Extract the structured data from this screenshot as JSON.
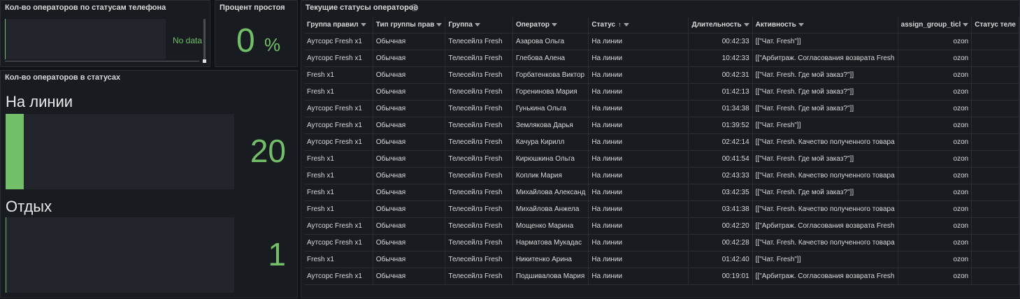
{
  "panel_phone": {
    "title": "Кол-во операторов по статусам телефона",
    "no_data": "No data"
  },
  "panel_idle": {
    "title": "Процент простоя",
    "value": "0",
    "unit": "%"
  },
  "panel_status": {
    "title": "Кол-во операторов в статусах",
    "gauges": [
      {
        "label": "На линии",
        "value": "20",
        "fill_fraction": 0.08
      },
      {
        "label": "Отдых",
        "value": "1",
        "fill_fraction": 0.0
      }
    ]
  },
  "panel_table": {
    "title": "Текущие статусы операторов",
    "columns": [
      "Группа правил",
      "Тип группы прав",
      "Группа",
      "Оператор",
      "Статус",
      "Длительность",
      "Активность",
      "assign_group_ticl",
      "Статус теле"
    ],
    "rows": [
      [
        "Аутсорс Fresh x1",
        "Обычная",
        "Телесейлз Fresh",
        "Азарова Ольга",
        "На линии",
        "00:42:33",
        "[[\"Чат. Fresh\"]]",
        "ozon",
        ""
      ],
      [
        "Аутсорс Fresh x1",
        "Обычная",
        "Телесейлз Fresh",
        "Глебова Алена",
        "На линии",
        "10:42:33",
        "[[\"Арбитраж. Согласования возврата Fresh",
        "ozon",
        ""
      ],
      [
        "Fresh x1",
        "Обычная",
        "Телесейлз Fresh",
        "Горбатенкова Виктор",
        "На линии",
        "00:42:31",
        "[[\"Чат. Fresh. Где мой заказ?\"]]",
        "ozon",
        ""
      ],
      [
        "Fresh x1",
        "Обычная",
        "Телесейлз Fresh",
        "Горенинова Мария",
        "На линии",
        "01:42:13",
        "[[\"Чат. Fresh. Где мой заказ?\"]]",
        "ozon",
        ""
      ],
      [
        "Аутсорс Fresh x1",
        "Обычная",
        "Телесейлз Fresh",
        "Гунькина Ольга",
        "На линии",
        "01:34:38",
        "[[\"Чат. Fresh. Где мой заказ?\"]]",
        "ozon",
        ""
      ],
      [
        "Аутсорс Fresh x1",
        "Обычная",
        "Телесейлз Fresh",
        "Землякова Дарья",
        "На линии",
        "01:39:52",
        "[[\"Чат. Fresh\"]]",
        "ozon",
        ""
      ],
      [
        "Аутсорс Fresh x1",
        "Обычная",
        "Телесейлз Fresh",
        "Качура Кирилл",
        "На линии",
        "02:42:14",
        "[[\"Чат. Fresh. Качество полученного товара",
        "ozon",
        ""
      ],
      [
        "Fresh x1",
        "Обычная",
        "Телесейлз Fresh",
        "Кирюшкина Ольга",
        "На линии",
        "00:41:54",
        "[[\"Чат. Fresh. Где мой заказ?\"]]",
        "ozon",
        ""
      ],
      [
        "Fresh x1",
        "Обычная",
        "Телесейлз Fresh",
        "Коплик Мария",
        "На линии",
        "02:43:33",
        "[[\"Чат. Fresh. Качество полученного товара",
        "ozon",
        ""
      ],
      [
        "Fresh x1",
        "Обычная",
        "Телесейлз Fresh",
        "Михайлова Александ",
        "На линии",
        "03:42:35",
        "[[\"Чат. Fresh. Где мой заказ?\"]]",
        "ozon",
        ""
      ],
      [
        "Fresh x1",
        "Обычная",
        "Телесейлз Fresh",
        "Михайлова Анжела",
        "На линии",
        "03:41:38",
        "[[\"Чат. Fresh. Качество полученного товара",
        "ozon",
        ""
      ],
      [
        "Аутсорс Fresh x1",
        "Обычная",
        "Телесейлз Fresh",
        "Мощенко Марина",
        "На линии",
        "00:42:20",
        "[[\"Арбитраж. Согласования возврата Fresh",
        "ozon",
        ""
      ],
      [
        "Аутсорс Fresh x1",
        "Обычная",
        "Телесейлз Fresh",
        "Нарматова Мукадас",
        "На линии",
        "00:42:28",
        "[[\"Чат. Fresh. Качество полученного товара",
        "ozon",
        ""
      ],
      [
        "Fresh x1",
        "Обычная",
        "Телесейлз Fresh",
        "Никитенко Арина",
        "На линии",
        "01:42:40",
        "[[\"Чат. Fresh\"]]",
        "ozon",
        ""
      ],
      [
        "Аутсорс Fresh x1",
        "Обычная",
        "Телесейлз Fresh",
        "Подшивалова Мария",
        "На линии",
        "00:19:01",
        "[[\"Арбитраж. Согласования возврата Fresh",
        "ozon",
        ""
      ]
    ]
  },
  "colors": {
    "accent_green": "#73bf69",
    "panel_bg": "#181b1f",
    "page_bg": "#111217"
  }
}
